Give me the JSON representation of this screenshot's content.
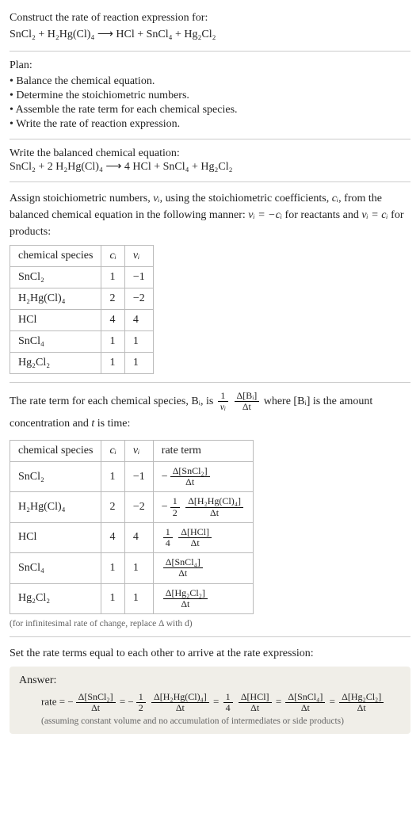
{
  "intro": {
    "line1": "Construct the rate of reaction expression for:",
    "eqn": "SnCl₂ + H₂Hg(Cl)₄  ⟶  HCl + SnCl₄ + Hg₂Cl₂"
  },
  "plan": {
    "heading": "Plan:",
    "items": [
      "Balance the chemical equation.",
      "Determine the stoichiometric numbers.",
      "Assemble the rate term for each chemical species.",
      "Write the rate of reaction expression."
    ]
  },
  "balanced": {
    "heading": "Write the balanced chemical equation:",
    "eqn": "SnCl₂ + 2 H₂Hg(Cl)₄  ⟶  4 HCl + SnCl₄ + Hg₂Cl₂"
  },
  "stoich": {
    "intro_a": "Assign stoichiometric numbers, ",
    "nu_i": "νᵢ",
    "intro_b": ", using the stoichiometric coefficients, ",
    "c_i": "cᵢ",
    "intro_c": ", from the balanced chemical equation in the following manner: ",
    "rel1": "νᵢ = −cᵢ",
    "intro_d": " for reactants and ",
    "rel2": "νᵢ = cᵢ",
    "intro_e": " for products:",
    "headers": [
      "chemical species",
      "cᵢ",
      "νᵢ"
    ],
    "rows": [
      {
        "sp": "SnCl₂",
        "c": "1",
        "nu": "−1"
      },
      {
        "sp": "H₂Hg(Cl)₄",
        "c": "2",
        "nu": "−2"
      },
      {
        "sp": "HCl",
        "c": "4",
        "nu": "4"
      },
      {
        "sp": "SnCl₄",
        "c": "1",
        "nu": "1"
      },
      {
        "sp": "Hg₂Cl₂",
        "c": "1",
        "nu": "1"
      }
    ]
  },
  "rateterm": {
    "intro_a": "The rate term for each chemical species, Bᵢ, is ",
    "frac1_num": "1",
    "frac1_den": "νᵢ",
    "frac2_num": "Δ[Bᵢ]",
    "frac2_den": "Δt",
    "intro_b": " where [Bᵢ] is the amount concentration and ",
    "t": "t",
    "intro_c": " is time:",
    "headers": [
      "chemical species",
      "cᵢ",
      "νᵢ",
      "rate term"
    ],
    "rows": [
      {
        "sp": "SnCl₂",
        "c": "1",
        "nu": "−1",
        "pre": "−",
        "num": "Δ[SnCl₂]",
        "den": "Δt"
      },
      {
        "sp": "H₂Hg(Cl)₄",
        "c": "2",
        "nu": "−2",
        "pre": "−",
        "coef_num": "1",
        "coef_den": "2",
        "num": "Δ[H₂Hg(Cl)₄]",
        "den": "Δt"
      },
      {
        "sp": "HCl",
        "c": "4",
        "nu": "4",
        "coef_num": "1",
        "coef_den": "4",
        "num": "Δ[HCl]",
        "den": "Δt"
      },
      {
        "sp": "SnCl₄",
        "c": "1",
        "nu": "1",
        "num": "Δ[SnCl₄]",
        "den": "Δt"
      },
      {
        "sp": "Hg₂Cl₂",
        "c": "1",
        "nu": "1",
        "num": "Δ[Hg₂Cl₂]",
        "den": "Δt"
      }
    ],
    "note": "(for infinitesimal rate of change, replace Δ with d)"
  },
  "final": {
    "heading": "Set the rate terms equal to each other to arrive at the rate expression:",
    "answer_label": "Answer:",
    "rate_label": "rate = ",
    "terms": [
      {
        "pre": "−",
        "num": "Δ[SnCl₂]",
        "den": "Δt"
      },
      {
        "pre": "−",
        "coef_num": "1",
        "coef_den": "2",
        "num": "Δ[H₂Hg(Cl)₄]",
        "den": "Δt"
      },
      {
        "coef_num": "1",
        "coef_den": "4",
        "num": "Δ[HCl]",
        "den": "Δt"
      },
      {
        "num": "Δ[SnCl₄]",
        "den": "Δt"
      },
      {
        "num": "Δ[Hg₂Cl₂]",
        "den": "Δt"
      }
    ],
    "eq": " = ",
    "note": "(assuming constant volume and no accumulation of intermediates or side products)"
  },
  "chart_data": {
    "type": "table",
    "tables": [
      {
        "title": "Stoichiometric numbers",
        "headers": [
          "chemical species",
          "c_i",
          "nu_i"
        ],
        "rows": [
          [
            "SnCl2",
            1,
            -1
          ],
          [
            "H2Hg(Cl)4",
            2,
            -2
          ],
          [
            "HCl",
            4,
            4
          ],
          [
            "SnCl4",
            1,
            1
          ],
          [
            "Hg2Cl2",
            1,
            1
          ]
        ]
      },
      {
        "title": "Rate terms",
        "headers": [
          "chemical species",
          "c_i",
          "nu_i",
          "rate term"
        ],
        "rows": [
          [
            "SnCl2",
            1,
            -1,
            "-Δ[SnCl2]/Δt"
          ],
          [
            "H2Hg(Cl)4",
            2,
            -2,
            "-(1/2) Δ[H2Hg(Cl)4]/Δt"
          ],
          [
            "HCl",
            4,
            4,
            "(1/4) Δ[HCl]/Δt"
          ],
          [
            "SnCl4",
            1,
            1,
            "Δ[SnCl4]/Δt"
          ],
          [
            "Hg2Cl2",
            1,
            1,
            "Δ[Hg2Cl2]/Δt"
          ]
        ]
      }
    ]
  }
}
